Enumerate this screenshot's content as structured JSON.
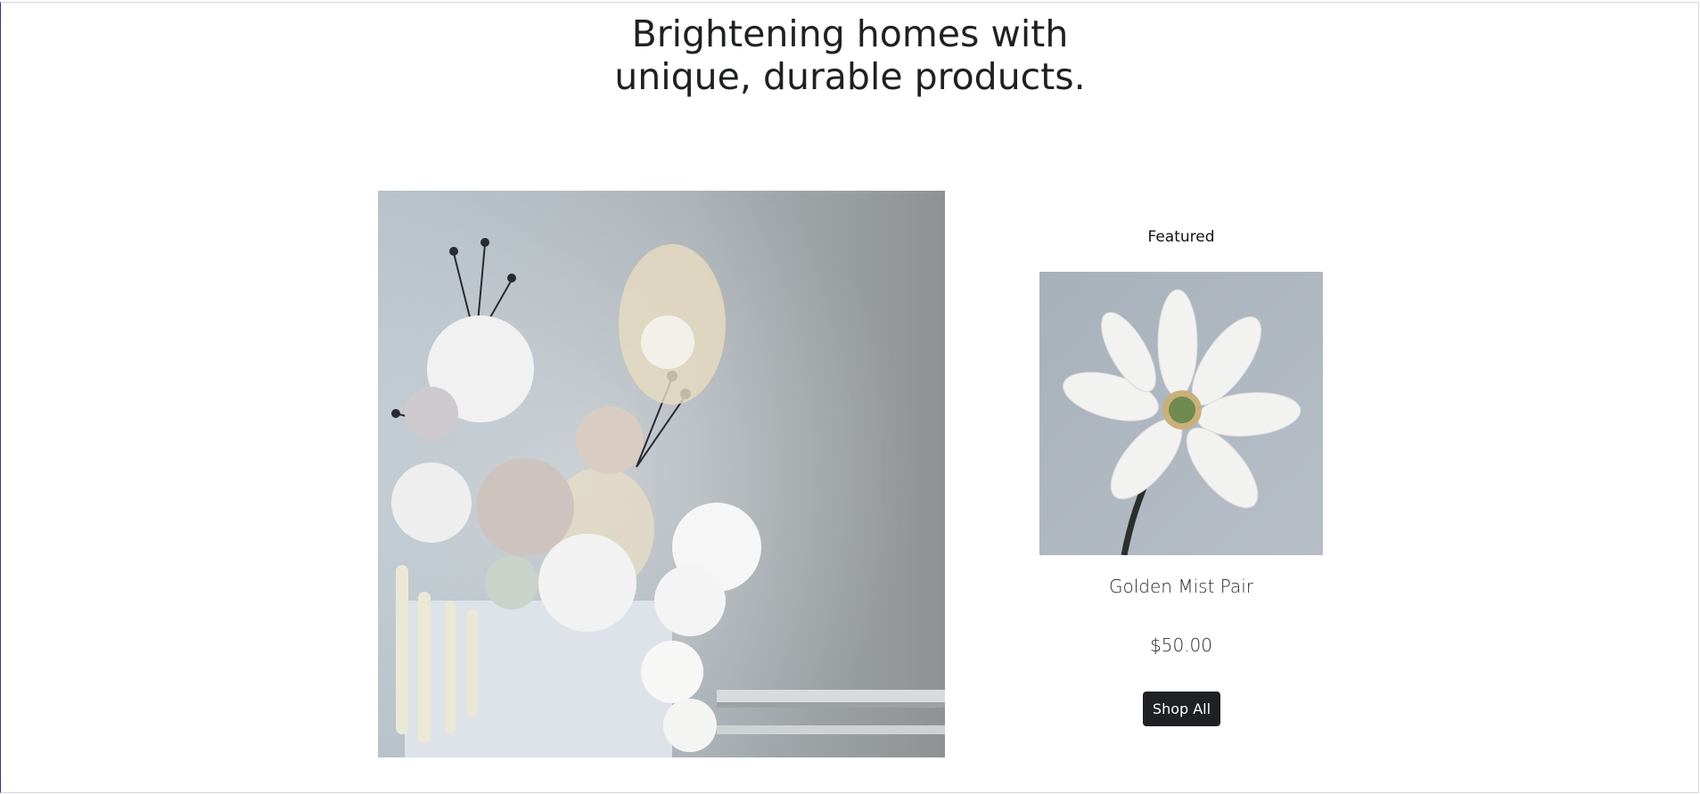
{
  "hero": {
    "line1": "Brightening homes with",
    "line2": "unique, durable products."
  },
  "featured": {
    "label": "Featured",
    "product_name": "Golden Mist Pair",
    "price": "$50.00",
    "button_label": "Shop All"
  },
  "colors": {
    "button_bg": "#1f2124",
    "text": "#1e2023"
  }
}
